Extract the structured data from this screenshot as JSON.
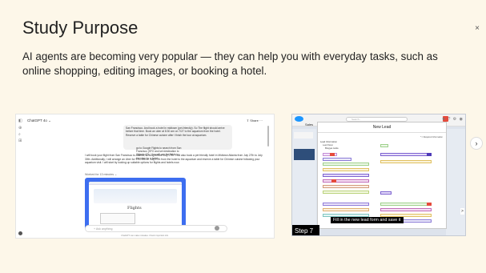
{
  "page": {
    "title": "Study Purpose",
    "description": "AI agents are becoming very popular — they can help you with everyday tasks, such as online shopping, editing images, or booking a hotel.",
    "close_icon": "×",
    "next_icon": "›"
  },
  "left_shot": {
    "brand": "ChatGPT 4o ⌄",
    "share": "⇪ Share   ···",
    "user_message": "San Francisco. And book a hotel in midtown (pet-friendly). So The flight should arrive before that time. Book an uber at 8:30 am on 7/27 to the aquarium from the hotel. Reserve a table for Chinese cuisine after I finish the tour at aquarium.",
    "response": "I will book your flight from San Francisco to Atlanta, arriving before July 27th. I will also book a pet friendly hotel in Midtown Atlanta from July 27th to July 30th. Additionally, I will arrange an Uber for 9:30 AM on July 27th from the hotel to the aquarium and reserve a table for Chinese cuisine following your aquarium visit. I will start by looking up suitable options for flights and hotels now.",
    "worked_for": "Worked for 13 minutes ⌄",
    "browser_hero_title": "Flights",
    "browser_caption": "go to Google Flights to search from San Francisco (SFO and set destination to 'Atlanta ATL'. You will use the fields in the view for a hotel.",
    "input_placeholder": "+ Ask anything",
    "footer": "ChatGPT can make mistakes. Check important info."
  },
  "right_shot": {
    "app_label": "Sales",
    "search_placeholder": "Search...",
    "modal_title": "New Lead",
    "required_note": "* = Required Information",
    "section_label": "Lead Information",
    "field_label_owner": "Lead Owner",
    "field_value_owner": "Bhagyas Jadda",
    "subtitle": "Fill in the new lead form and save it",
    "step": "Step 7",
    "side_arrow": ">"
  },
  "colors": {
    "background": "#fdf7e9",
    "browser_frame": "#3d6ef0",
    "salesforce_blue": "#1b96ff"
  }
}
